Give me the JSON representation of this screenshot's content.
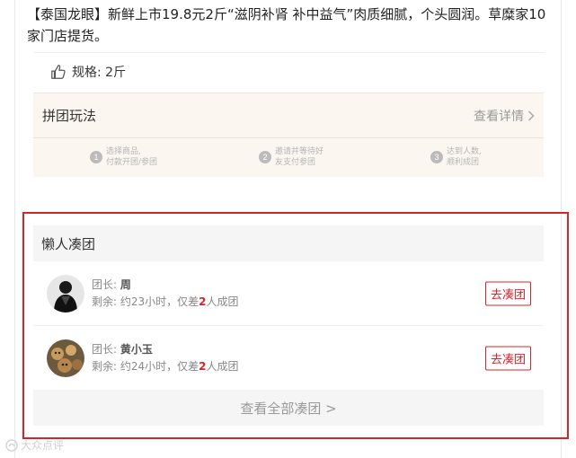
{
  "product": {
    "description": "【泰国龙眼】新鲜上市19.8元2斤“滋阴补肾 补中益气”肉质细腻，个头圆润。草糜家10家门店提货。",
    "spec": "规格: 2斤"
  },
  "rules": {
    "title": "拼团玩法",
    "detail_link": "查看详情",
    "steps": [
      {
        "num": "1",
        "line1": "选择商品,",
        "line2": "付款开团/参团"
      },
      {
        "num": "2",
        "line1": "邀请并等待好",
        "line2": "友支付参团"
      },
      {
        "num": "3",
        "line1": "达到人数,",
        "line2": "顺利成团"
      }
    ]
  },
  "lazy": {
    "title": "懒人凑团",
    "groups": [
      {
        "leader_label": "团长:",
        "leader_name": "周",
        "remain_prefix": "剩余: 约23小时，仅差",
        "count": "2",
        "remain_suffix": "人成团",
        "button": "去凑团"
      },
      {
        "leader_label": "团长:",
        "leader_name": "黄小玉",
        "remain_prefix": "剩余: 约24小时，仅差",
        "count": "2",
        "remain_suffix": "人成团",
        "button": "去凑团"
      }
    ],
    "see_all": "查看全部凑团 >"
  },
  "watermark": "大众点评",
  "colors": {
    "accent": "#d9232a",
    "rules_bg": "#fcf6f1"
  }
}
